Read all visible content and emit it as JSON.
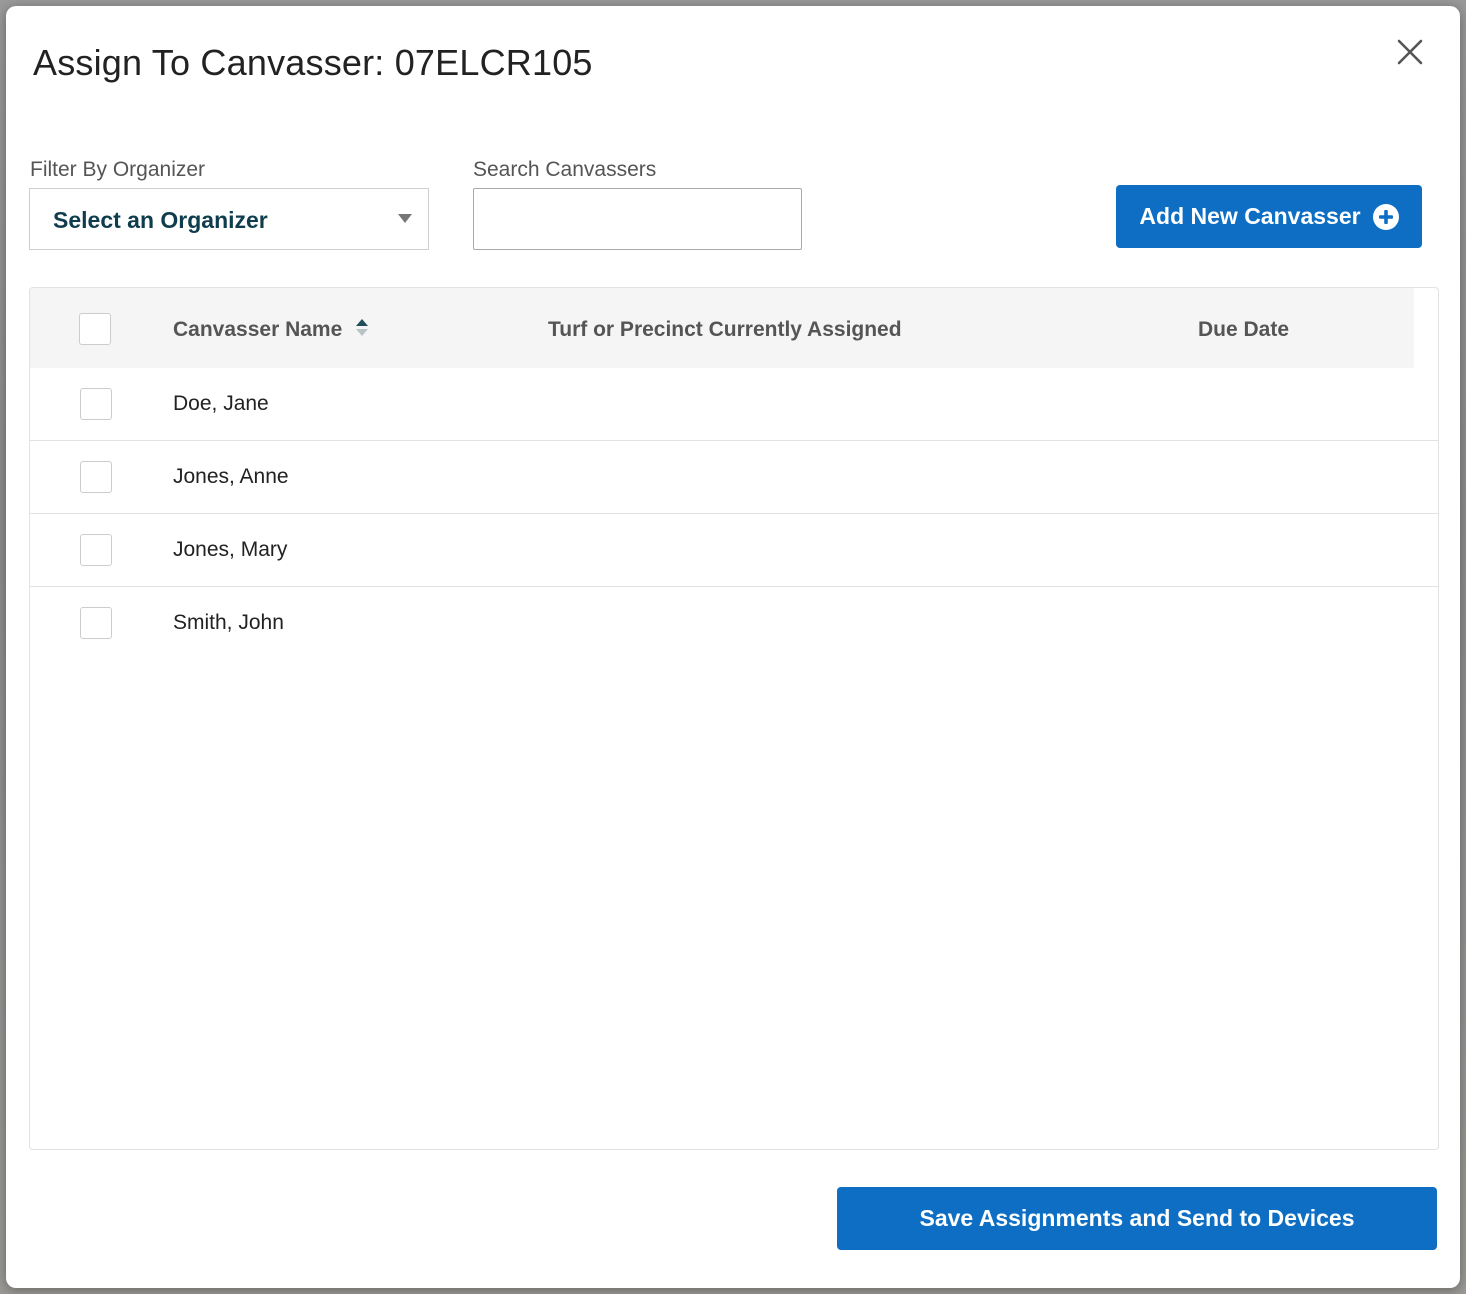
{
  "modal": {
    "title": "Assign To Canvasser: 07ELCR105"
  },
  "filter": {
    "label": "Filter By Organizer",
    "selected": "Select an Organizer"
  },
  "search": {
    "label": "Search Canvassers",
    "value": "",
    "placeholder": ""
  },
  "actions": {
    "add_new_label": "Add New Canvasser",
    "save_label": "Save Assignments and Send to Devices"
  },
  "table": {
    "columns": {
      "name": "Canvasser Name",
      "turf": "Turf or Precinct Currently Assigned",
      "due": "Due Date"
    },
    "rows": [
      {
        "name": "Doe, Jane",
        "turf": "",
        "due": ""
      },
      {
        "name": "Jones, Anne",
        "turf": "",
        "due": ""
      },
      {
        "name": "Jones, Mary",
        "turf": "",
        "due": ""
      },
      {
        "name": "Smith, John",
        "turf": "",
        "due": ""
      }
    ]
  },
  "colors": {
    "primary": "#0d6ec4",
    "select_text": "#0f3d4d",
    "header_bg": "#f5f5f5"
  },
  "icons": [
    "close-icon",
    "chevron-down-icon",
    "plus-circle-icon",
    "sort-icon"
  ]
}
